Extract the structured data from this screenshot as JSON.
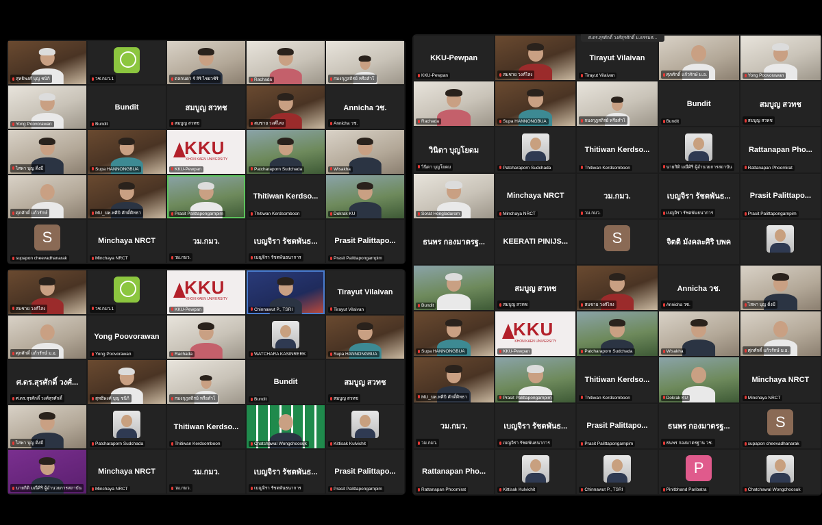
{
  "colors": {
    "avatar_s": "#8a6a55",
    "avatar_p": "#e05a8c",
    "speaking": "#5cc35c",
    "muted": "#e53935"
  },
  "panel_tl": {
    "tiles": [
      {
        "kind": "video",
        "style": "v-shelf",
        "person": "grey",
        "label": "สุทธิพงศ์ บุญ ชนิกิ"
      },
      {
        "kind": "logo-nrct",
        "label": "วช.กมว.1",
        "caption": "วช. NRCT"
      },
      {
        "kind": "video",
        "style": "v-light",
        "person": "dark",
        "label": "ดลกนดา ร์ สิริ ไชยวชิริ"
      },
      {
        "kind": "video",
        "style": "v-office",
        "person": "pink",
        "label": "Rachada"
      },
      {
        "kind": "video",
        "style": "v-office",
        "person": "small",
        "label": "กมงกุฎสถิรย์ หรือสำโ"
      },
      {
        "kind": "video",
        "style": "v-office",
        "person": "grey",
        "label": "Yong Poovorawan"
      },
      {
        "kind": "name",
        "name": "Bundit",
        "label": "Bundit"
      },
      {
        "kind": "name",
        "name": "สมบูญ สวทช",
        "label": "สมบูญ สวทช"
      },
      {
        "kind": "video",
        "style": "v-shelf",
        "person": "red",
        "label": "สมชาย วงศ์ไสง"
      },
      {
        "kind": "name",
        "name": "Annicha วช.",
        "label": "Annicha วช."
      },
      {
        "kind": "video",
        "style": "v-light",
        "person": "dark",
        "label": "ไสพา บุญ ดิ่งมี"
      },
      {
        "kind": "video",
        "style": "v-shelf",
        "person": "teal",
        "label": "Supa HANNONGBUA"
      },
      {
        "kind": "logo-kku",
        "label": "KKU-Pewpan",
        "caption": "KKU",
        "sub": "KHON KAEN UNIVERSITY"
      },
      {
        "kind": "video",
        "style": "v-green",
        "person": "dark",
        "label": "Patcharaporn Sudchada"
      },
      {
        "kind": "video",
        "style": "v-light",
        "person": "dark",
        "label": "Wisakha"
      },
      {
        "kind": "video",
        "style": "v-light",
        "person": "none",
        "label": "ศุภศักดิ์ แก้วรักษ์"
      },
      {
        "kind": "video",
        "style": "v-shelf",
        "person": "dark",
        "label": "MU_นพ.ทศิบิ ศักดิ์ศิทธา"
      },
      {
        "kind": "video",
        "style": "v-green",
        "person": "grey",
        "label": "Prasit Palittapongarnpim",
        "speaking": true
      },
      {
        "kind": "name",
        "name": "Thitiwan Kerdso...",
        "label": "Thitiwan Kerdsomboon"
      },
      {
        "kind": "video",
        "style": "v-green",
        "person": "dark",
        "label": "Dokrak KU"
      },
      {
        "kind": "avatar",
        "letter": "S",
        "label": "supapon cheevadhanarak"
      },
      {
        "kind": "name",
        "name": "Minchaya NRCT",
        "label": "Minchaya NRCT"
      },
      {
        "kind": "name",
        "name": "วม.กมว.",
        "label": "วม.กมว."
      },
      {
        "kind": "name",
        "name": "เบญจิรา รัชตพันธ...",
        "label": "เบญจิรา รัชตพันธนาการ"
      },
      {
        "kind": "name",
        "name": "Prasit Palittapo...",
        "label": "Prasit Palittapongarnpim"
      }
    ]
  },
  "panel_bl": {
    "tiles": [
      {
        "kind": "video",
        "style": "v-shelf",
        "person": "red",
        "label": "สมชาย วงศ์ไสง"
      },
      {
        "kind": "logo-nrct",
        "label": "วช.กมว.1",
        "caption": "วช. NRCT"
      },
      {
        "kind": "logo-kku",
        "label": "KKU-Pewpan",
        "caption": "KKU",
        "sub": "KHON KAEN UNIVERSITY"
      },
      {
        "kind": "video",
        "style": "v-blue",
        "person": "dark",
        "label": "Chinnawut P., TSRI",
        "speaking_blue": true
      },
      {
        "kind": "name",
        "name": "Tirayut Vilaivan",
        "label": "Tirayut Vilaivan"
      },
      {
        "kind": "video",
        "style": "v-light",
        "person": "none",
        "label": "ศุภศักดิ์ แก้วรักษ์ ม.อ."
      },
      {
        "kind": "name",
        "name": "Yong Poovorawan",
        "label": "Yong Poovorawan"
      },
      {
        "kind": "video",
        "style": "v-office",
        "person": "pink",
        "label": "Rachada"
      },
      {
        "kind": "portrait",
        "label": "WATCHARA KASINRERK"
      },
      {
        "kind": "video",
        "style": "v-shelf",
        "person": "teal",
        "label": "Supa HANNONGBUA"
      },
      {
        "kind": "name",
        "name": "ศ.ดร.สุรศักดิ์ วงศ์...",
        "label": "ศ.ดร.สุรศักดิ์ วงศ์สุรศักดิ์"
      },
      {
        "kind": "video",
        "style": "v-shelf",
        "person": "grey",
        "label": "สุทธิพงศ์ บุญ ชนิกิ"
      },
      {
        "kind": "video",
        "style": "v-office",
        "person": "small",
        "label": "กมงกุฎสถิรย์ หรือสำโ"
      },
      {
        "kind": "name",
        "name": "Bundit",
        "label": "Bundit"
      },
      {
        "kind": "name",
        "name": "สมบูญ สวทช",
        "label": "สมบูญ สวทช"
      },
      {
        "kind": "video",
        "style": "v-light",
        "person": "dark",
        "label": "ไสพา บุญ ดิ่งมี"
      },
      {
        "kind": "portrait",
        "label": "Patcharaporn Sudchada"
      },
      {
        "kind": "name",
        "name": "Thitiwan Kerdso...",
        "label": "Thitiwan Kerdsomboon"
      },
      {
        "kind": "logo-ku",
        "label": "Chatchawal Wongchoosuk"
      },
      {
        "kind": "portrait",
        "label": "Kittisak Kulvichit"
      },
      {
        "kind": "video",
        "style": "v-purple",
        "person": "dark",
        "label": "นายกิติ มณีศิริ ผู้อำนวยการสถาบัน"
      },
      {
        "kind": "name",
        "name": "Minchaya NRCT",
        "label": "Minchaya NRCT"
      },
      {
        "kind": "name",
        "name": "วม.กมว.",
        "label": "วม.กมว."
      },
      {
        "kind": "name",
        "name": "เบญจิรา รัชตพันธ...",
        "label": "เบญจิรา รัชตพันธนาการ"
      },
      {
        "kind": "name",
        "name": "Prasit Palittapo...",
        "label": "Prasit Palittapongarnpim"
      }
    ]
  },
  "panel_r": {
    "banner": "ศ.ดร.สุรศักดิ์ วงศ์สุรศักดิ์ ม.ธรรมศ...",
    "tiles": [
      {
        "kind": "name",
        "name": "KKU-Pewpan",
        "label": "KKU-Pewpan"
      },
      {
        "kind": "video",
        "style": "v-shelf",
        "person": "red",
        "label": "สมชาย วงศ์ไสง"
      },
      {
        "kind": "name",
        "name": "Tirayut Vilaivan",
        "label": "Tirayut Vilaivan"
      },
      {
        "kind": "video",
        "style": "v-light",
        "person": "none",
        "label": "ศุภศักดิ์ แก้วรักษ์ ม.อ."
      },
      {
        "kind": "video",
        "style": "v-office",
        "person": "grey",
        "label": "Yong Poovorawan"
      },
      {
        "kind": "video",
        "style": "v-office",
        "person": "pink",
        "label": "Rachada"
      },
      {
        "kind": "video",
        "style": "v-shelf",
        "person": "teal",
        "label": "Supa HANNONGBUA"
      },
      {
        "kind": "video",
        "style": "v-office",
        "person": "small",
        "label": "กมงกุฎสถิรย์ หรือสำโ"
      },
      {
        "kind": "name",
        "name": "Bundit",
        "label": "Bundit"
      },
      {
        "kind": "name",
        "name": "สมบูญ สวทช",
        "label": "สมบูญ สวทช"
      },
      {
        "kind": "name",
        "name": "วินิตา บุญโยดม",
        "label": "วินิตา บุญโยดม"
      },
      {
        "kind": "portrait",
        "label": "Patcharaporn Sudchada"
      },
      {
        "kind": "name",
        "name": "Thitiwan Kerdso...",
        "label": "Thitiwan Kerdsomboon"
      },
      {
        "kind": "portrait",
        "label": "นายกิติ มณีศิริ ผู้อำนวยการสถาบัน"
      },
      {
        "kind": "name",
        "name": "Rattanapan Pho...",
        "label": "Rattanapan Phoomirat"
      },
      {
        "kind": "video",
        "style": "v-office",
        "person": "grey",
        "label": "Sorat Hongladarom"
      },
      {
        "kind": "name",
        "name": "Minchaya NRCT",
        "label": "Minchaya NRCT"
      },
      {
        "kind": "name",
        "name": "วม.กมว.",
        "label": "วม.กมว."
      },
      {
        "kind": "name",
        "name": "เบญจิรา รัชตพันธ...",
        "label": "เบญจิรา รัชตพันธนาการ"
      },
      {
        "kind": "name",
        "name": "Prasit Palittapo...",
        "label": "Prasit Palittapongarnpim"
      },
      {
        "kind": "name",
        "name": "ธนพร กองมาตรฐ...",
        "label": ""
      },
      {
        "kind": "name",
        "name": "KEERATI PINIJS...",
        "label": ""
      },
      {
        "kind": "avatar",
        "letter": "S",
        "label": ""
      },
      {
        "kind": "name",
        "name": "จิตติ มังคละศิริ บพค",
        "label": ""
      },
      {
        "kind": "portrait",
        "label": ""
      },
      {
        "kind": "video",
        "style": "v-green",
        "person": "grey",
        "label": "Bundit"
      },
      {
        "kind": "name",
        "name": "สมบูญ สวทช",
        "label": "สมบูญ สวทช"
      },
      {
        "kind": "video",
        "style": "v-shelf",
        "person": "red",
        "label": "สมชาย วงศ์ไสง"
      },
      {
        "kind": "name",
        "name": "Annicha วช.",
        "label": "Annicha วช."
      },
      {
        "kind": "video",
        "style": "v-light",
        "person": "dark",
        "label": "ไสพา บุญ ดิ่งมี"
      },
      {
        "kind": "video",
        "style": "v-shelf",
        "person": "teal",
        "label": "Supa HANNONGBUA"
      },
      {
        "kind": "logo-kku",
        "label": "KKU-Pewpan",
        "caption": "KKU",
        "sub": "KHON KAEN UNIVERSITY"
      },
      {
        "kind": "video",
        "style": "v-green",
        "person": "dark",
        "label": "Patcharaporn Sudchada"
      },
      {
        "kind": "video",
        "style": "v-light",
        "person": "dark",
        "label": "Wisakha"
      },
      {
        "kind": "video",
        "style": "v-light",
        "person": "none",
        "label": "ศุภศักดิ์ แก้วรักษ์ ม.อ."
      },
      {
        "kind": "video",
        "style": "v-shelf",
        "person": "dark",
        "label": "MU_นพ.ทศิบิ ศักดิ์ศิทธา"
      },
      {
        "kind": "video",
        "style": "v-green",
        "person": "grey",
        "label": "Prasit Palittapongarnpim"
      },
      {
        "kind": "name",
        "name": "Thitiwan Kerdso...",
        "label": "Thitiwan Kerdsomboon"
      },
      {
        "kind": "video",
        "style": "v-green",
        "person": "none",
        "label": "Dokrak KU"
      },
      {
        "kind": "name",
        "name": "Minchaya NRCT",
        "label": "Minchaya NRCT"
      },
      {
        "kind": "name",
        "name": "วม.กมว.",
        "label": "วม.กมว."
      },
      {
        "kind": "name",
        "name": "เบญจิรา รัชตพันธ...",
        "label": "เบญจิรา รัชตพันธนาการ"
      },
      {
        "kind": "name",
        "name": "Prasit Palittapo...",
        "label": "Prasit Palittapongarnpim"
      },
      {
        "kind": "name",
        "name": "ธนพร กองมาตรฐ...",
        "label": "ธนพร กองมาตรฐาน วช."
      },
      {
        "kind": "avatar",
        "letter": "S",
        "label": "supapon cheevadhanarak"
      },
      {
        "kind": "name",
        "name": "Rattanapan Pho...",
        "label": "Rattanapan Phoomirat"
      },
      {
        "kind": "portrait",
        "label": "Kittisak Kulvichit"
      },
      {
        "kind": "portrait",
        "label": "Chinnawut P., TSRI"
      },
      {
        "kind": "avatar",
        "letter": "P",
        "label": "Pinitbhand Paribatra"
      },
      {
        "kind": "portrait",
        "label": "Chatchawal Wongchoosuk"
      }
    ]
  }
}
